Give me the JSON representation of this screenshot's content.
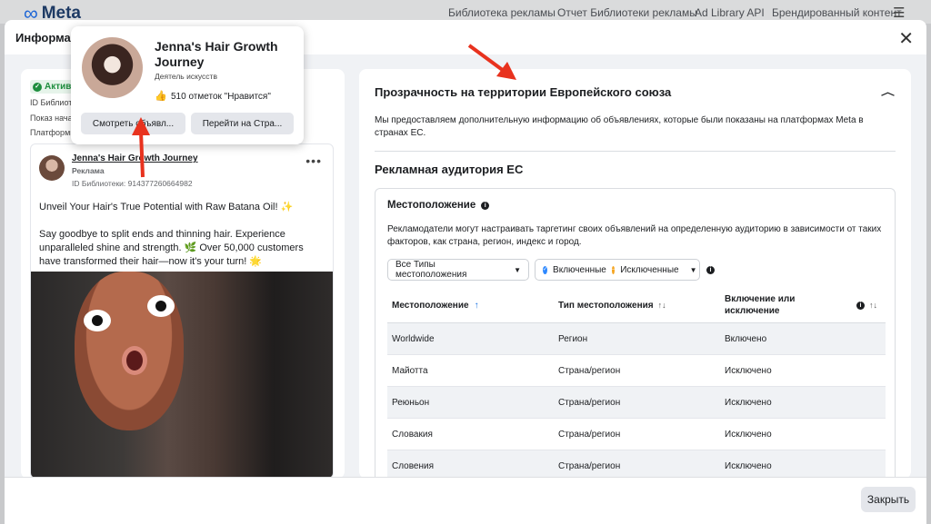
{
  "bg_header": {
    "logo": "Meta",
    "nav": [
      "Библиотека рекламы",
      "Отчет Библиотеки рекламы",
      "Ad Library API",
      "Брендированный контент"
    ]
  },
  "modal": {
    "title": "Информац",
    "close_label": "Закрыть"
  },
  "left": {
    "status": "Активн",
    "lines": [
      "ID Библиоте",
      "Показ начат",
      "Платформы"
    ],
    "ad": {
      "page_name": "Jenna's Hair Growth Journey",
      "sponsored": "Реклама",
      "library_id": "ID Библиотеки: 914377260664982",
      "text1": "Unveil Your Hair's True Potential with Raw Batana Oil! ✨",
      "text2": "Say goodbye to split ends and thinning hair. Experience unparalleled shine and strength. 🌿 Over 50,000 customers have transformed their hair—now it's your turn! 🌟"
    }
  },
  "popup": {
    "name": "Jenna's Hair Growth Journey",
    "category": "Деятель искусств",
    "likes": "510 отметок \"Нравится\"",
    "btn_ads": "Смотреть объявл...",
    "btn_page": "Перейти на Стра..."
  },
  "right": {
    "section_title": "Прозрачность на территории Европейского союза",
    "description": "Мы предоставляем дополнительную информацию об объявлениях, которые были показаны на платформах Meta в странах ЕС.",
    "audience_title": "Рекламная аудитория ЕС",
    "location_heading": "Местоположение",
    "location_desc": "Рекламодатели могут настраивать таргетинг своих объявлений на определенную аудиторию в зависимости от таких факторов, как страна, регион, индекс и город.",
    "filter_types": "Все Типы местоположения",
    "filter_included": "Включенные",
    "filter_excluded": "Исключенные",
    "table": {
      "headers": [
        "Местоположение",
        "Тип местоположения",
        "Включение или исключение"
      ],
      "rows": [
        [
          "Worldwide",
          "Регион",
          "Включено"
        ],
        [
          "Майотта",
          "Страна/регион",
          "Исключено"
        ],
        [
          "Реюньон",
          "Страна/регион",
          "Исключено"
        ],
        [
          "Словакия",
          "Страна/регион",
          "Исключено"
        ],
        [
          "Словения",
          "Страна/регион",
          "Исключено"
        ]
      ]
    }
  },
  "colors": {
    "arrow": "#e8321e",
    "accent": "#1b74e4",
    "active_green": "#1e8e3e"
  }
}
